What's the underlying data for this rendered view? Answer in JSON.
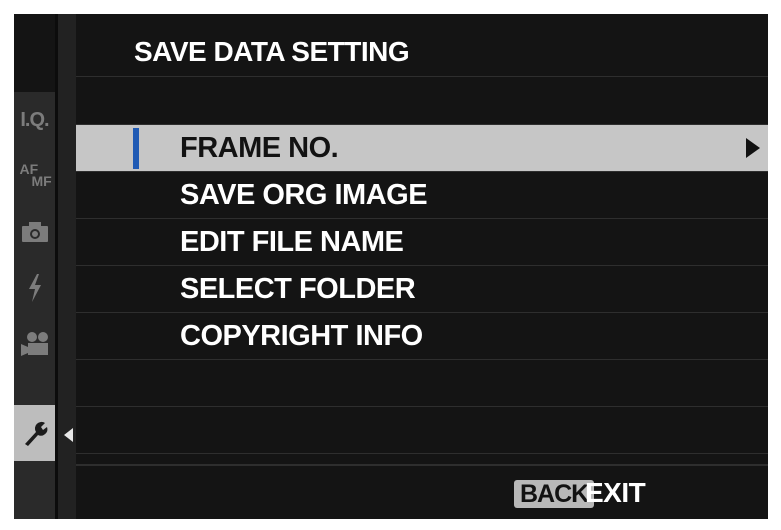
{
  "screen_title": "SAVE DATA SETTING",
  "sidebar": {
    "tabs": [
      {
        "name": "image-quality",
        "label": "I.Q.",
        "icon": "iq-icon",
        "active": false
      },
      {
        "name": "af-mf",
        "label_af": "AF",
        "label_mf": "MF",
        "icon": "af-mf-icon",
        "active": false
      },
      {
        "name": "shooting",
        "icon": "camera-icon",
        "active": false
      },
      {
        "name": "flash",
        "icon": "flash-icon",
        "active": false
      },
      {
        "name": "movie",
        "icon": "movie-camera-icon",
        "active": false
      },
      {
        "name": "setup",
        "icon": "wrench-icon",
        "active": true
      }
    ]
  },
  "menu": {
    "items": [
      {
        "label": "FRAME NO.",
        "selected": true
      },
      {
        "label": "SAVE ORG IMAGE",
        "selected": false
      },
      {
        "label": "EDIT FILE NAME",
        "selected": false
      },
      {
        "label": "SELECT FOLDER",
        "selected": false
      },
      {
        "label": "COPYRIGHT INFO",
        "selected": false
      }
    ]
  },
  "footer": {
    "back_button": "BACK",
    "exit_label": "EXIT"
  },
  "colors": {
    "background": "#141414",
    "highlight": "#c6c6c6",
    "selection_bar": "#1f5ab4",
    "sidebar": "#2a2a2a"
  }
}
